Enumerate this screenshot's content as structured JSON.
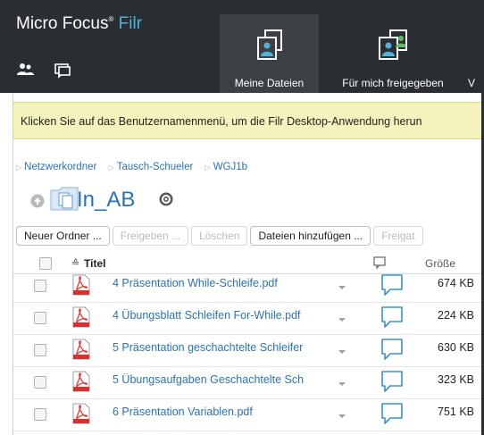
{
  "app": {
    "brand_name": "Micro Focus",
    "brand_reg": "®",
    "brand_product": "Filr"
  },
  "nav": {
    "tabs": [
      {
        "label": "Meine Dateien",
        "icon": "my-files-icon",
        "active": true
      },
      {
        "label": "Für mich freigegeben",
        "icon": "shared-with-me-icon",
        "active": false
      },
      {
        "label": "V",
        "icon": "truncated-tab-icon",
        "active": false
      }
    ],
    "people_icon": "people-icon",
    "comments_icon": "comment-icon"
  },
  "notice": {
    "text": "Klicken Sie auf das Benutzernamenmenü, um die Filr Desktop-Anwendung herun"
  },
  "breadcrumb": [
    "Netzwerkordner",
    "Tausch-Schueler",
    "WGJ1b"
  ],
  "folder": {
    "title": "In_AB"
  },
  "toolbar": {
    "buttons": [
      {
        "label": "Neuer Ordner ...",
        "enabled": true
      },
      {
        "label": "Freigeben ...",
        "enabled": false
      },
      {
        "label": "Löschen",
        "enabled": false
      },
      {
        "label": "Dateien hinzufügen ...",
        "enabled": true
      },
      {
        "label": "Freigat",
        "enabled": false
      }
    ]
  },
  "table": {
    "sort_indicator": "≙",
    "columns": {
      "title": "Titel",
      "size": "Größe"
    },
    "rows": [
      {
        "name": "4 Präsentation While-Schleife.pdf",
        "size": "674 KB"
      },
      {
        "name": "4 Übungsblatt Schleifen For-While.pdf",
        "size": "224 KB"
      },
      {
        "name": "5 Präsentation geschachtelte Schleifer",
        "size": "630 KB"
      },
      {
        "name": "5 Übungsaufgaben Geschachtelte Sch",
        "size": "323 KB"
      },
      {
        "name": "6 Präsentation Variablen.pdf",
        "size": "751 KB"
      }
    ]
  },
  "colors": {
    "header_bg": "#2a2e32",
    "accent": "#2a73b6",
    "filr_accent": "#4fb3d8",
    "notice_bg": "#f5f3bd",
    "pdf_red": "#d9302f"
  }
}
